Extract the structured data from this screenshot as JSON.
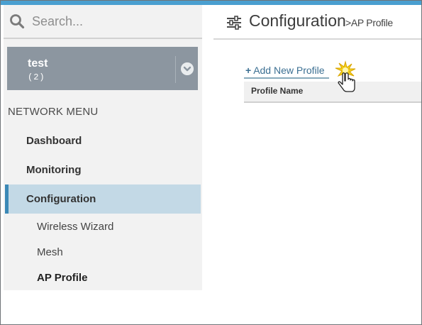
{
  "search": {
    "placeholder": "Search..."
  },
  "network": {
    "name": "test",
    "count": "(2)"
  },
  "menu": {
    "heading": "NETWORK MENU",
    "items": [
      {
        "label": "Dashboard"
      },
      {
        "label": "Monitoring"
      },
      {
        "label": "Configuration",
        "active": true
      }
    ],
    "sub_items": [
      {
        "label": "Wireless Wizard"
      },
      {
        "label": "Mesh"
      },
      {
        "label": "AP Profile",
        "active": true
      }
    ]
  },
  "header": {
    "title": "Configuration",
    "breadcrumb": ">AP Profile"
  },
  "actions": {
    "add_profile": "Add New Profile"
  },
  "table": {
    "columns": [
      "Profile Name"
    ]
  },
  "colors": {
    "accent": "#3b88b6",
    "active_bg": "#c3d9e6",
    "network_card": "#8c96a0",
    "link": "#3b6f92"
  }
}
